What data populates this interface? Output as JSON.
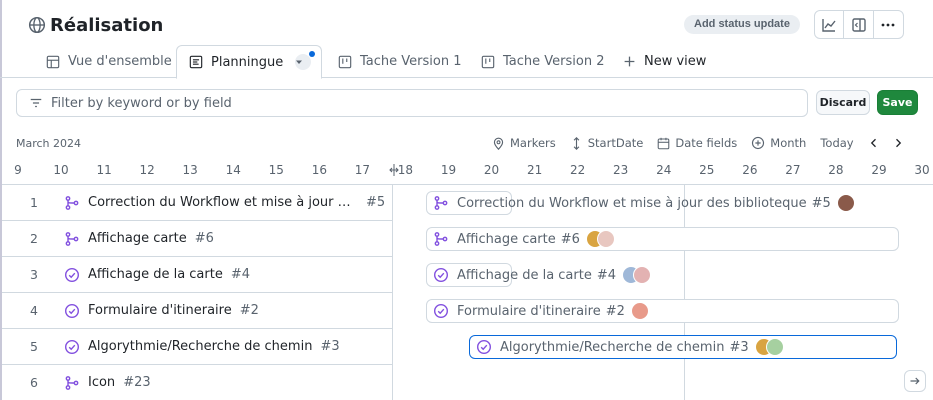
{
  "header": {
    "title": "Réalisation",
    "status_button": "Add status update"
  },
  "tabs": [
    {
      "label": "Vue d'ensemble",
      "icon": "table-icon"
    },
    {
      "label": "Plannningue",
      "icon": "roadmap-icon"
    },
    {
      "label": "Tache Version 1",
      "icon": "board-icon"
    },
    {
      "label": "Tache Version 2",
      "icon": "board-icon"
    },
    {
      "label": "New view",
      "icon": "plus-icon"
    }
  ],
  "active_tab_label": "Planningue",
  "filter": {
    "placeholder": "Filter by keyword or by field",
    "value": ""
  },
  "buttons": {
    "discard": "Discard",
    "save": "Save"
  },
  "timeline": {
    "month": "March 2024",
    "toolbar": {
      "markers": "Markers",
      "start_date": "StartDate",
      "date_fields": "Date fields",
      "zoom": "Month",
      "today": "Today"
    },
    "days": [
      "9",
      "10",
      "11",
      "12",
      "13",
      "14",
      "15",
      "16",
      "17",
      "18",
      "19",
      "20",
      "21",
      "22",
      "23",
      "24",
      "25",
      "26",
      "27",
      "28",
      "29",
      "30"
    ]
  },
  "items": [
    {
      "num": "1",
      "title": "Correction du Workflow et mise à jour des bi...",
      "bar_title": "Correction du Workflow et mise à jour des biblioteque",
      "ref": "#5",
      "type": "issue-branch"
    },
    {
      "num": "2",
      "title": "Affichage carte",
      "bar_title": "Affichage carte",
      "ref": "#6",
      "type": "issue-branch"
    },
    {
      "num": "3",
      "title": "Affichage de la carte",
      "bar_title": "Affichage de la carte",
      "ref": "#4",
      "type": "issue-closed"
    },
    {
      "num": "4",
      "title": "Formulaire d'itineraire",
      "bar_title": "Formulaire d'itineraire",
      "ref": "#2",
      "type": "issue-closed"
    },
    {
      "num": "5",
      "title": "Algorythmie/Recherche de chemin",
      "bar_title": "Algorythmie/Recherche de chemin",
      "ref": "#3",
      "type": "issue-closed"
    },
    {
      "num": "6",
      "title": "Icon",
      "bar_title": "",
      "ref": "#23",
      "type": "issue-branch"
    }
  ],
  "colors": {
    "accent": "#8250df",
    "save": "#1f883d",
    "selected": "#0969da"
  }
}
